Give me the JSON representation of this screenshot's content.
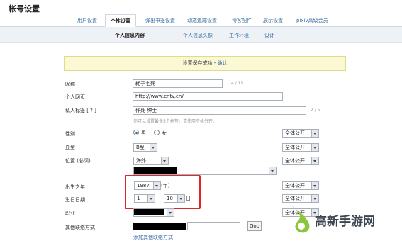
{
  "page_title": "帐号设置",
  "tabs": [
    "用户设置",
    "个性设置",
    "弹出书签设置",
    "动态追踪设置",
    "博客配件",
    "展示设置",
    "pixiv高级会员"
  ],
  "subnav": [
    "个人信息内容",
    "个人信息头像",
    "工作环境",
    "设计"
  ],
  "notice": {
    "text": "设置保存成功 -",
    "link": "确认"
  },
  "labels": {
    "nickname": "昵称",
    "homepage": "个人网页",
    "tags": "私人标签 [ ? ]",
    "gender": "性别",
    "blood": "血型",
    "location": "位置 (必须)",
    "birth_year": "出生之年",
    "birthday": "生日日期",
    "job": "职业",
    "contact": "其他联络方式"
  },
  "fields": {
    "nickname": "耗子宅死",
    "nickname_count": "4 / 15",
    "homepage": "http://www.cntv.cn/",
    "tags": "作死 绅士",
    "tags_count": "2 / 5",
    "tags_hint": "你可以设置最多5个标签。请使用空格分开。",
    "gender_male": "男",
    "gender_female": "女",
    "blood": "B型",
    "location": "海外",
    "birth_year": "1987",
    "birth_year_unit": "(年)",
    "birth_month": "1",
    "birth_sep": "一",
    "birth_day": "10",
    "birth_day_unit": "日",
    "contact_btn": "Goo",
    "add_contact": "添加其他联络方式"
  },
  "privacy": "全体公开",
  "watermark": "高新手游网",
  "colors": {
    "link": "#3a6ea5",
    "highlight": "#e0252b",
    "notice_bg": "#fbf8d4",
    "logo_green": "#8cc63f"
  }
}
